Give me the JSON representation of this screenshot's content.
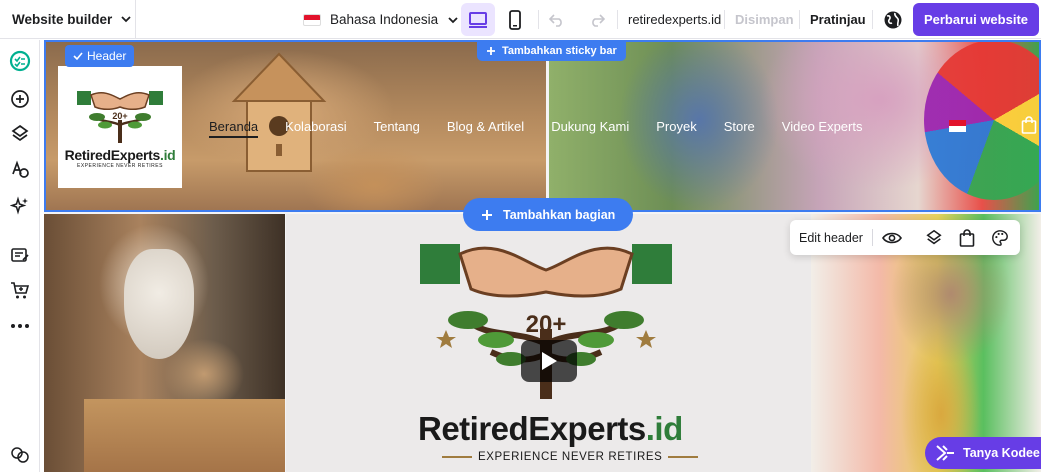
{
  "topbar": {
    "brand_label": "Website builder",
    "language": "Bahasa Indonesia",
    "domain": "retiredexperts.id",
    "saved_label": "Disimpan",
    "preview_label": "Pratinjau",
    "publish_label": "Perbarui website"
  },
  "colors": {
    "accent_purple": "#673de6",
    "selection_blue": "#3d7cf0",
    "brand_green": "#2f7d3a"
  },
  "icons": {
    "rail": [
      "checklist-icon",
      "add-element-icon",
      "layers-icon",
      "styles-icon",
      "ai-tools-icon",
      "blog-icon",
      "store-icon",
      "more-icon",
      "help-icon"
    ]
  },
  "header": {
    "tag_label": "Header",
    "sticky_label": "Tambahkan sticky bar",
    "logo_badge": "20+",
    "logo_name_main": "RetiredExperts",
    "logo_name_suffix": ".id",
    "logo_tagline": "EXPERIENCE NEVER RETIRES",
    "nav": [
      "Beranda",
      "Kolaborasi",
      "Tentang",
      "Blog & Artikel",
      "Dukung Kami",
      "Proyek",
      "Store",
      "Video Experts"
    ]
  },
  "canvas": {
    "add_section_label": "Tambahkan bagian",
    "edit_header_label": "Edit header"
  },
  "hero": {
    "logo_name_main": "RetiredExperts",
    "logo_name_suffix": ".id",
    "tagline": "EXPERIENCE NEVER RETIRES",
    "badge": "20+"
  },
  "assistant": {
    "label": "Tanya Kodee"
  }
}
